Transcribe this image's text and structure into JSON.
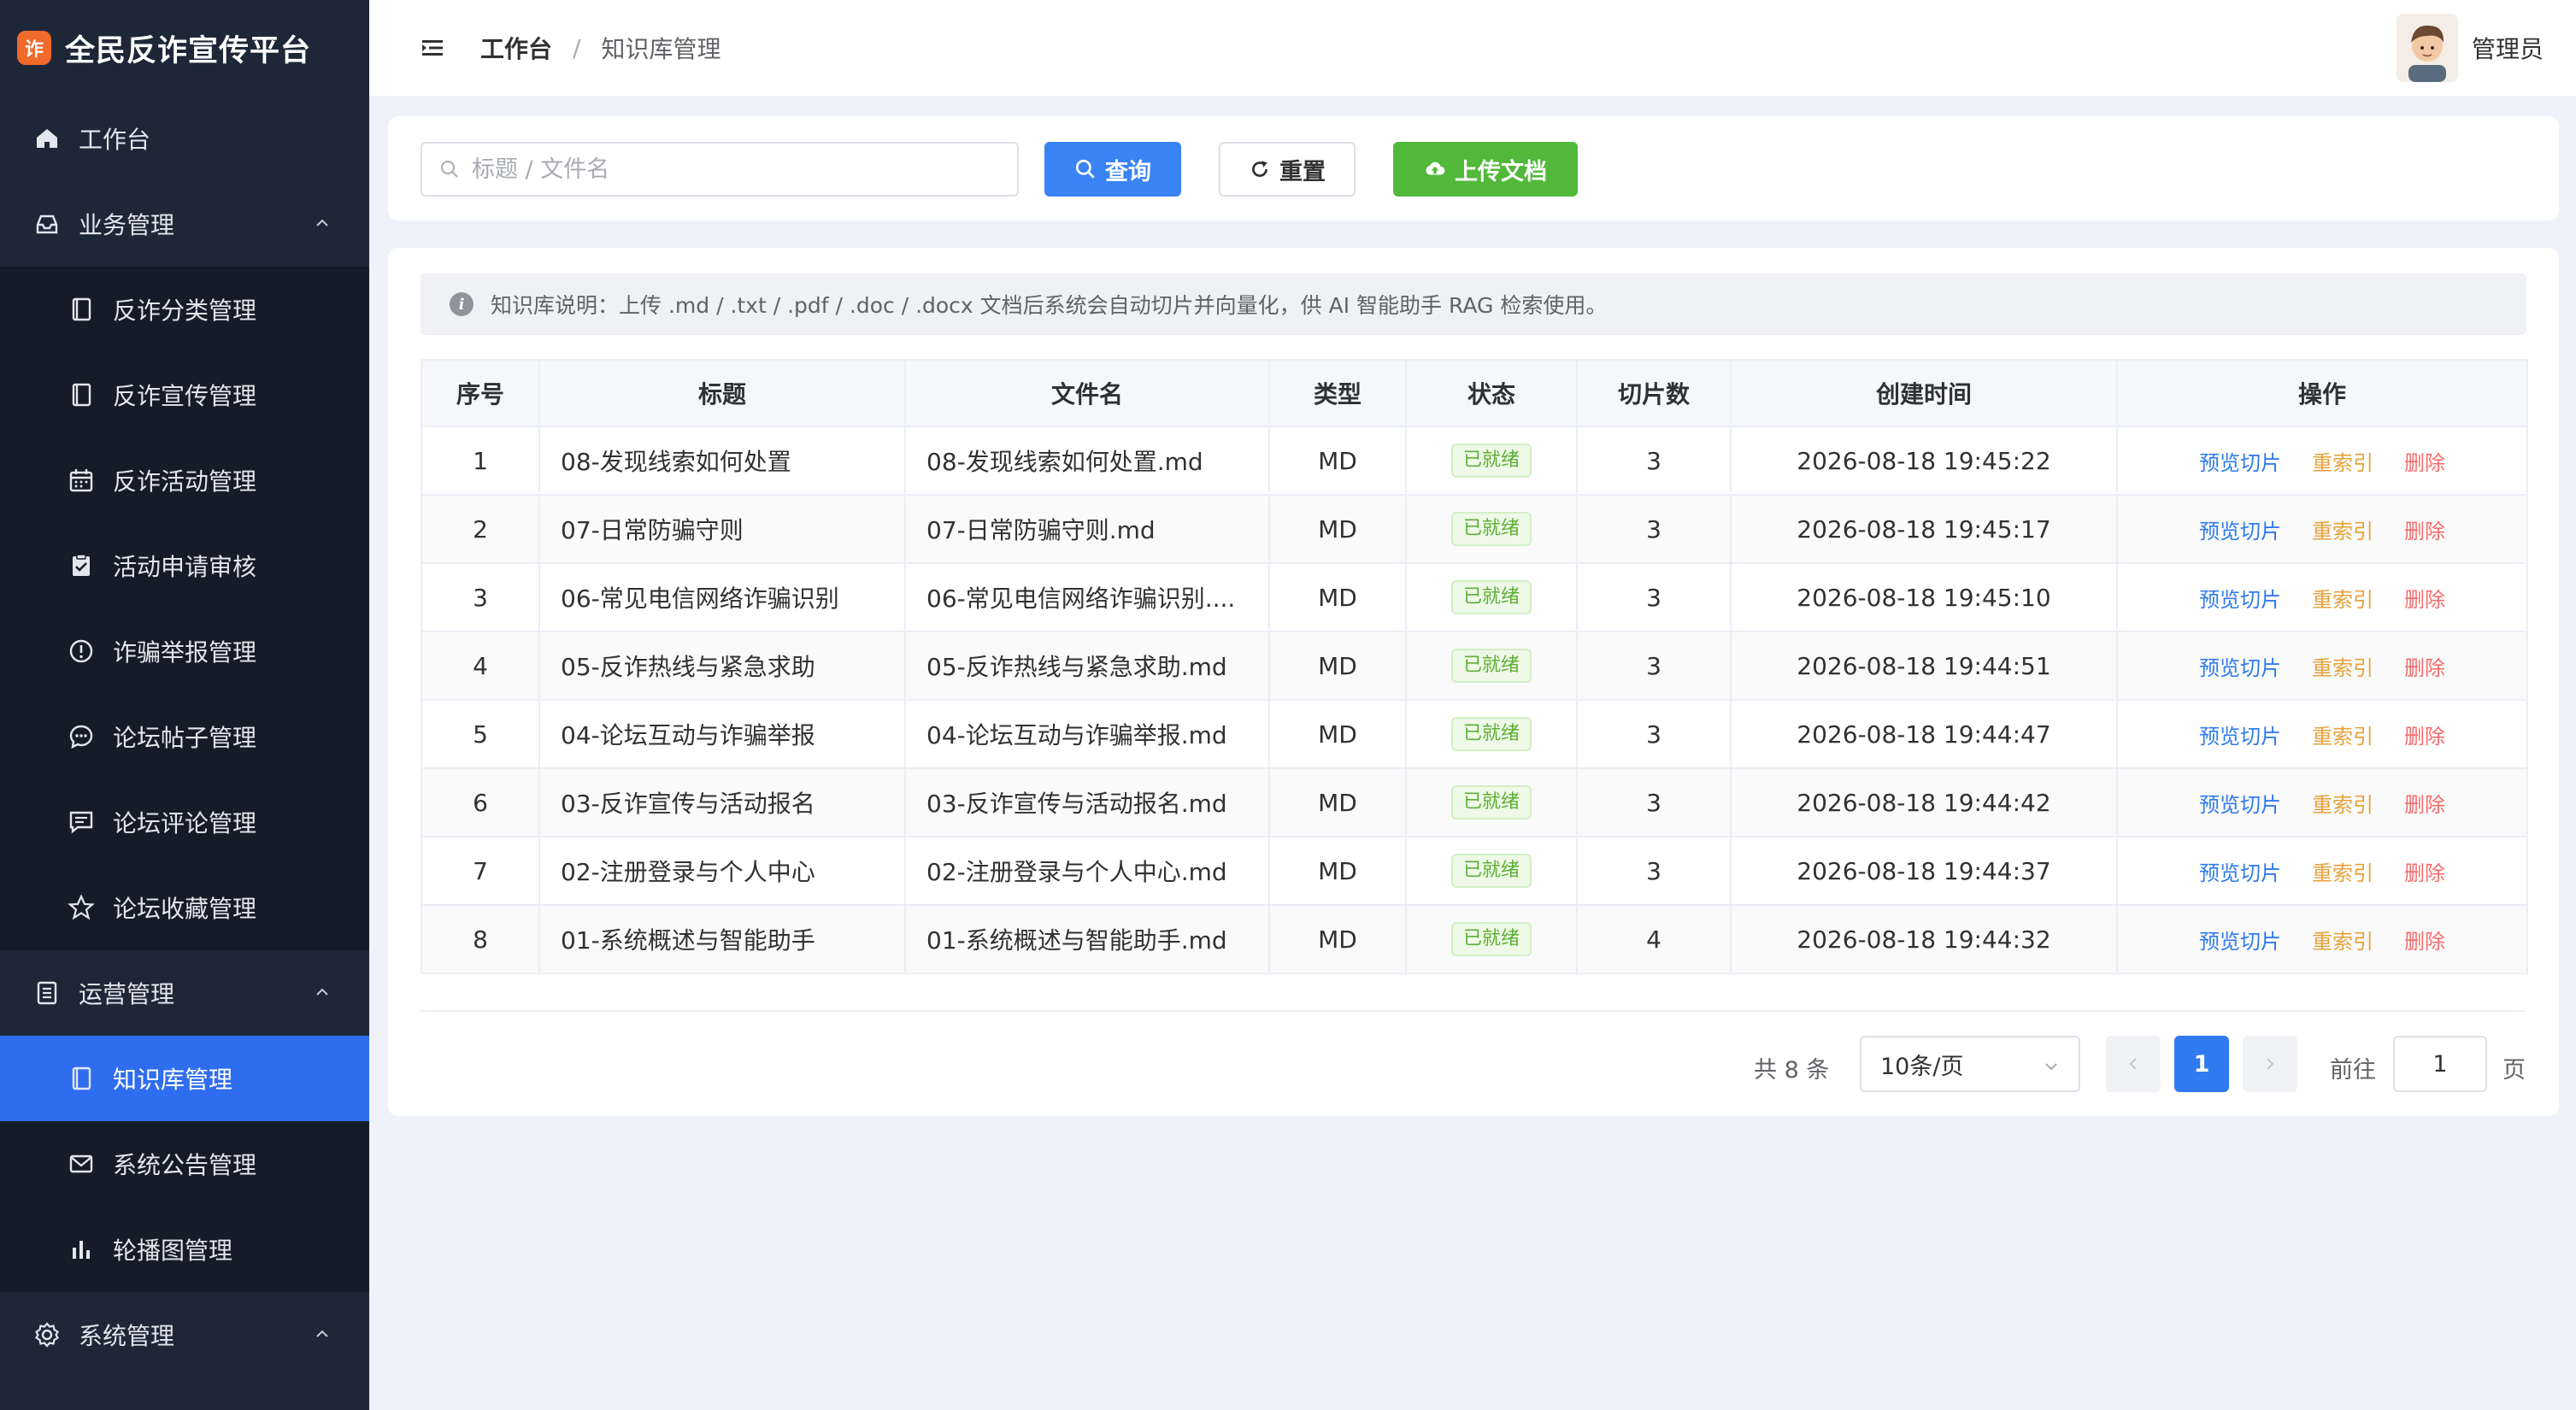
{
  "brand": {
    "logo_char": "诈",
    "title": "全民反诈宣传平台"
  },
  "sidebar": {
    "items": [
      {
        "label": "工作台",
        "icon": "home-icon",
        "type": "top"
      },
      {
        "label": "业务管理",
        "icon": "inbox-icon",
        "type": "group",
        "expanded": true
      },
      {
        "label": "反诈分类管理",
        "icon": "notebook-icon",
        "type": "sub"
      },
      {
        "label": "反诈宣传管理",
        "icon": "notebook-icon",
        "type": "sub"
      },
      {
        "label": "反诈活动管理",
        "icon": "calendar-icon",
        "type": "sub"
      },
      {
        "label": "活动申请审核",
        "icon": "clipboard-check-icon",
        "type": "sub"
      },
      {
        "label": "诈骗举报管理",
        "icon": "warning-icon",
        "type": "sub"
      },
      {
        "label": "论坛帖子管理",
        "icon": "chat-dot-icon",
        "type": "sub"
      },
      {
        "label": "论坛评论管理",
        "icon": "chat-square-icon",
        "type": "sub"
      },
      {
        "label": "论坛收藏管理",
        "icon": "star-icon",
        "type": "sub"
      },
      {
        "label": "运营管理",
        "icon": "tickets-icon",
        "type": "group",
        "expanded": true
      },
      {
        "label": "知识库管理",
        "icon": "notebook-icon",
        "type": "sub",
        "active": true
      },
      {
        "label": "系统公告管理",
        "icon": "message-icon",
        "type": "sub"
      },
      {
        "label": "轮播图管理",
        "icon": "histogram-icon",
        "type": "sub"
      },
      {
        "label": "系统管理",
        "icon": "gear-icon",
        "type": "group",
        "expanded": true
      }
    ]
  },
  "header": {
    "breadcrumb_home": "工作台",
    "breadcrumb_sep": "/",
    "breadcrumb_current": "知识库管理",
    "user_name": "管理员"
  },
  "search": {
    "placeholder": "标题 / 文件名",
    "query_label": "查询",
    "reset_label": "重置",
    "upload_label": "上传文档"
  },
  "notice": "知识库说明：上传 .md / .txt / .pdf / .doc / .docx 文档后系统会自动切片并向量化，供 AI 智能助手 RAG 检索使用。",
  "table": {
    "columns": [
      "序号",
      "标题",
      "文件名",
      "类型",
      "状态",
      "切片数",
      "创建时间",
      "操作"
    ],
    "rows": [
      {
        "no": "1",
        "title": "08-发现线索如何处置",
        "file": "08-发现线索如何处置.md",
        "type": "MD",
        "status": "已就绪",
        "slices": "3",
        "created": "2026-08-18 19:45:22"
      },
      {
        "no": "2",
        "title": "07-日常防骗守则",
        "file": "07-日常防骗守则.md",
        "type": "MD",
        "status": "已就绪",
        "slices": "3",
        "created": "2026-08-18 19:45:17"
      },
      {
        "no": "3",
        "title": "06-常见电信网络诈骗识别",
        "file": "06-常见电信网络诈骗识别....",
        "type": "MD",
        "status": "已就绪",
        "slices": "3",
        "created": "2026-08-18 19:45:10"
      },
      {
        "no": "4",
        "title": "05-反诈热线与紧急求助",
        "file": "05-反诈热线与紧急求助.md",
        "type": "MD",
        "status": "已就绪",
        "slices": "3",
        "created": "2026-08-18 19:44:51"
      },
      {
        "no": "5",
        "title": "04-论坛互动与诈骗举报",
        "file": "04-论坛互动与诈骗举报.md",
        "type": "MD",
        "status": "已就绪",
        "slices": "3",
        "created": "2026-08-18 19:44:47"
      },
      {
        "no": "6",
        "title": "03-反诈宣传与活动报名",
        "file": "03-反诈宣传与活动报名.md",
        "type": "MD",
        "status": "已就绪",
        "slices": "3",
        "created": "2026-08-18 19:44:42"
      },
      {
        "no": "7",
        "title": "02-注册登录与个人中心",
        "file": "02-注册登录与个人中心.md",
        "type": "MD",
        "status": "已就绪",
        "slices": "3",
        "created": "2026-08-18 19:44:37"
      },
      {
        "no": "8",
        "title": "01-系统概述与智能助手",
        "file": "01-系统概述与智能助手.md",
        "type": "MD",
        "status": "已就绪",
        "slices": "4",
        "created": "2026-08-18 19:44:32"
      }
    ],
    "actions": {
      "preview": "预览切片",
      "reindex": "重索引",
      "delete": "删除"
    }
  },
  "pagination": {
    "total_text": "共 8 条",
    "page_size": "10条/页",
    "current_page": "1",
    "goto_label": "前往",
    "goto_value": "1",
    "goto_unit": "页"
  },
  "colors": {
    "sidebar_bg": "#1d2738",
    "active": "#2f6df0",
    "primary": "#3a83f4",
    "success": "#52b83a",
    "warning": "#e6a23c",
    "danger": "#f56c6c"
  }
}
